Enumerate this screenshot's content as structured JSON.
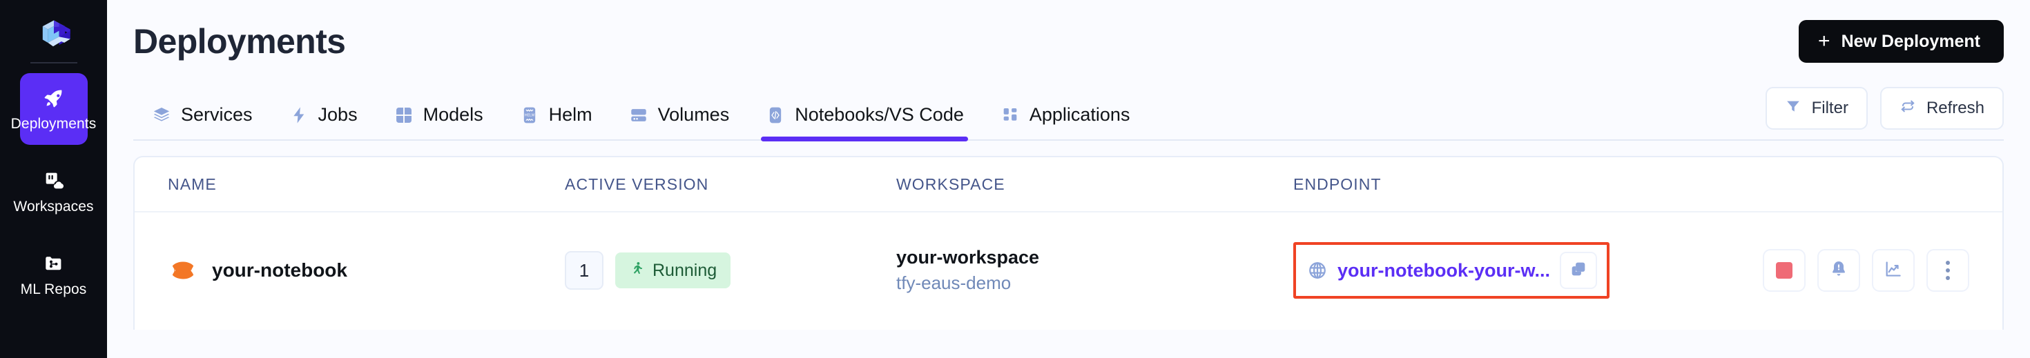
{
  "sidebar": {
    "logo": "truefoundry-cube-logo",
    "items": [
      {
        "label": "Deployments",
        "icon": "rocket-icon",
        "active": true
      },
      {
        "label": "Workspaces",
        "icon": "workspace-cloud-icon",
        "active": false
      },
      {
        "label": "ML Repos",
        "icon": "repo-folder-icon",
        "active": false
      }
    ]
  },
  "header": {
    "title": "Deployments",
    "new_deployment_label": "New Deployment",
    "plus_icon": "plus-icon"
  },
  "tabs": {
    "items": [
      {
        "label": "Services",
        "icon": "layers-icon",
        "active": false
      },
      {
        "label": "Jobs",
        "icon": "bolt-icon",
        "active": false
      },
      {
        "label": "Models",
        "icon": "grid-icon",
        "active": false
      },
      {
        "label": "Helm",
        "icon": "helm-icon",
        "active": false
      },
      {
        "label": "Volumes",
        "icon": "volume-disk-icon",
        "active": false
      },
      {
        "label": "Notebooks/VS Code",
        "icon": "code-brackets-icon",
        "active": true
      },
      {
        "label": "Applications",
        "icon": "apps-grid-icon",
        "active": false
      }
    ],
    "filter_label": "Filter",
    "filter_icon": "funnel-icon",
    "refresh_label": "Refresh",
    "refresh_icon": "refresh-icon"
  },
  "table": {
    "columns": {
      "name": "NAME",
      "active_version": "ACTIVE VERSION",
      "workspace": "WORKSPACE",
      "endpoint": "ENDPOINT"
    },
    "rows": [
      {
        "name": "your-notebook",
        "name_icon": "jupyter-icon",
        "version": "1",
        "status": "Running",
        "status_icon": "running-person-icon",
        "workspace_name": "your-workspace",
        "workspace_cluster": "tfy-eaus-demo",
        "endpoint": "your-notebook-your-w...",
        "endpoint_icon": "globe-icon",
        "copy_icon": "copy-icon",
        "actions": [
          {
            "name": "stop-button",
            "icon": "stop-square-icon"
          },
          {
            "name": "alerts-button",
            "icon": "bell-alert-icon"
          },
          {
            "name": "metrics-button",
            "icon": "line-chart-icon"
          },
          {
            "name": "more-button",
            "icon": "three-dots-icon"
          }
        ]
      }
    ]
  },
  "colors": {
    "accent": "#5b2ef5",
    "sidebar_bg": "#0b0d14",
    "page_bg": "#fafbff",
    "status_green_bg": "#d6f5df",
    "status_green_text": "#1d5b36",
    "annotation_red": "#f04324",
    "tab_icon_blue": "#8ca4da"
  }
}
